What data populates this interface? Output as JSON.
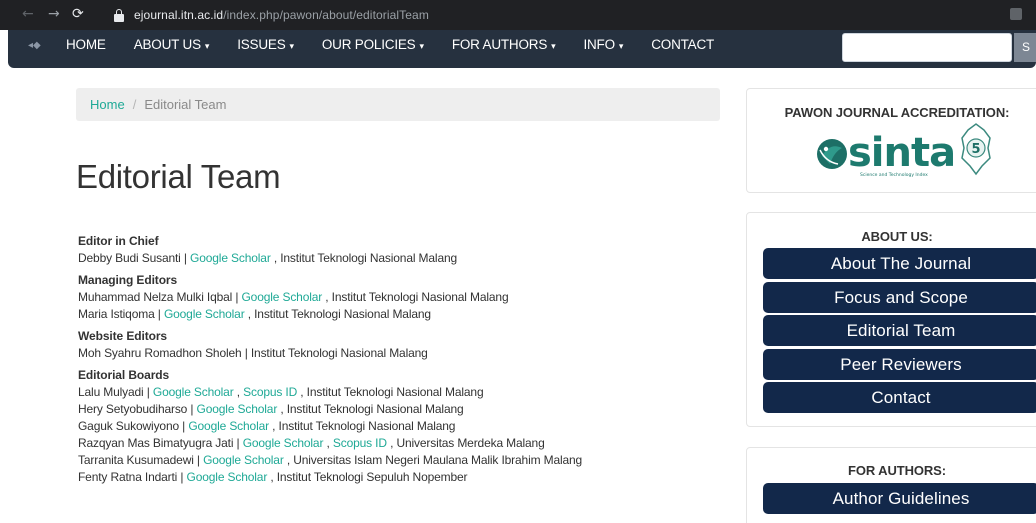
{
  "browser": {
    "url_domain": "ejournal.itn.ac.id",
    "url_path": "/index.php/pawon/about/editorialTeam"
  },
  "nav": {
    "items": [
      {
        "label": "HOME",
        "caret": ""
      },
      {
        "label": "ABOUT US",
        "caret": "▾"
      },
      {
        "label": "ISSUES",
        "caret": "▾"
      },
      {
        "label": "OUR POLICIES",
        "caret": "▾"
      },
      {
        "label": "FOR AUTHORS",
        "caret": "▾"
      },
      {
        "label": "INFO",
        "caret": "▾"
      },
      {
        "label": "CONTACT",
        "caret": ""
      }
    ],
    "search_button_label": "S"
  },
  "breadcrumb": {
    "home": "Home",
    "separator": "/",
    "current": "Editorial Team"
  },
  "page": {
    "title": "Editorial Team"
  },
  "sections": [
    {
      "heading": "Editor in Chief",
      "members": [
        {
          "parts": [
            {
              "t": "Debby Budi Susanti | "
            },
            {
              "t": "Google Scholar",
              "link": true
            },
            {
              "t": " , Institut Teknologi Nasional Malang"
            }
          ]
        }
      ]
    },
    {
      "heading": "Managing Editors",
      "members": [
        {
          "parts": [
            {
              "t": "Muhammad Nelza Mulki Iqbal | "
            },
            {
              "t": "Google Scholar",
              "link": true
            },
            {
              "t": " , Institut Teknologi Nasional Malang"
            }
          ]
        },
        {
          "parts": [
            {
              "t": "Maria Istiqoma | "
            },
            {
              "t": "Google Scholar",
              "link": true
            },
            {
              "t": " , Institut Teknologi Nasional Malang"
            }
          ]
        }
      ]
    },
    {
      "heading": "Website Editors",
      "members": [
        {
          "parts": [
            {
              "t": "Moh Syahru Romadhon Sholeh | Institut Teknologi Nasional Malang"
            }
          ]
        }
      ]
    },
    {
      "heading": "Editorial Boards",
      "members": [
        {
          "parts": [
            {
              "t": "Lalu Mulyadi | "
            },
            {
              "t": "Google Scholar",
              "link": true
            },
            {
              "t": " , "
            },
            {
              "t": "Scopus ID",
              "link": true
            },
            {
              "t": " , Institut Teknologi Nasional Malang"
            }
          ]
        },
        {
          "parts": [
            {
              "t": "Hery Setyobudiharso | "
            },
            {
              "t": "Google Scholar",
              "link": true
            },
            {
              "t": " , Institut Teknologi Nasional Malang"
            }
          ]
        },
        {
          "parts": [
            {
              "t": "Gaguk Sukowiyono | "
            },
            {
              "t": "Google Scholar",
              "link": true
            },
            {
              "t": " , Institut Teknologi Nasional Malang"
            }
          ]
        },
        {
          "parts": [
            {
              "t": "Razqyan Mas Bimatyugra Jati | "
            },
            {
              "t": "Google Scholar",
              "link": true
            },
            {
              "t": " , "
            },
            {
              "t": "Scopus ID",
              "link": true
            },
            {
              "t": " , Universitas Merdeka Malang"
            }
          ]
        },
        {
          "parts": [
            {
              "t": "Tarranita Kusumadewi | "
            },
            {
              "t": "Google Scholar",
              "link": true
            },
            {
              "t": " , Universitas Islam Negeri Maulana Malik Ibrahim Malang"
            }
          ]
        },
        {
          "parts": [
            {
              "t": "Fenty Ratna Indarti | "
            },
            {
              "t": "Google Scholar",
              "link": true
            },
            {
              "t": " , Institut Teknologi Sepuluh Nopember"
            }
          ]
        }
      ]
    }
  ],
  "sidebar": {
    "accreditation_title": "PAWON JOURNAL ACCREDITATION:",
    "sinta": {
      "logo_text": "sinta",
      "grade": "5",
      "tagline": "Science and Technology Index"
    },
    "about_title": "ABOUT US:",
    "about_buttons": [
      "About The Journal",
      "Focus and Scope",
      "Editorial Team",
      "Peer Reviewers",
      "Contact"
    ],
    "authors_title": "FOR AUTHORS:",
    "author_buttons": [
      "Author Guidelines"
    ]
  },
  "colors": {
    "nav_bg": "#26313f",
    "link": "#1fa996",
    "sidebar_button": "#12284a"
  }
}
